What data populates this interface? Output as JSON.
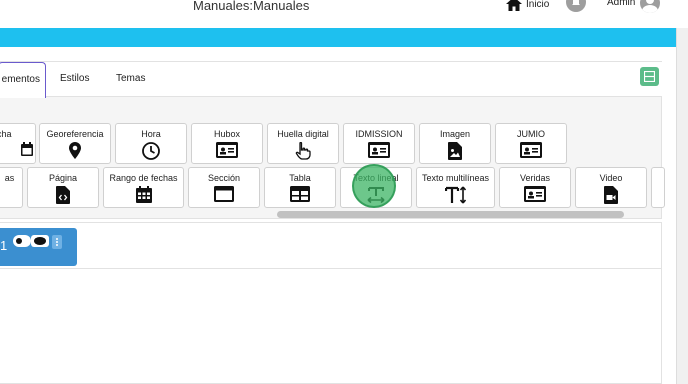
{
  "header": {
    "title": "Manuales:Manuales",
    "home_label": "Inicio",
    "user_label": "Admin"
  },
  "tabs": [
    {
      "label": "ementos"
    },
    {
      "label": "Estilos"
    },
    {
      "label": "Temas"
    }
  ],
  "components_row1": [
    {
      "label": "cha",
      "icon": "calendar-icon"
    },
    {
      "label": "Georeferencia",
      "icon": "map-pin-icon"
    },
    {
      "label": "Hora",
      "icon": "clock-icon"
    },
    {
      "label": "Hubox",
      "icon": "id-card-icon"
    },
    {
      "label": "Huella digital",
      "icon": "pointer-hand-icon"
    },
    {
      "label": "IDMISSION",
      "icon": "id-card-icon"
    },
    {
      "label": "Imagen",
      "icon": "image-file-icon"
    },
    {
      "label": "JUMIO",
      "icon": "id-card-icon"
    }
  ],
  "components_row2": [
    {
      "label": "as",
      "icon": "list-icon"
    },
    {
      "label": "Página",
      "icon": "code-file-icon"
    },
    {
      "label": "Rango de fechas",
      "icon": "calendar-grid-icon"
    },
    {
      "label": "Sección",
      "icon": "window-icon"
    },
    {
      "label": "Tabla",
      "icon": "table-icon"
    },
    {
      "label": "Texto lineal",
      "icon": "text-line-icon"
    },
    {
      "label": "Texto multilíneas",
      "icon": "text-height-icon"
    },
    {
      "label": "Veridas",
      "icon": "id-card-icon"
    },
    {
      "label": "Video",
      "icon": "video-file-icon"
    }
  ],
  "block": {
    "number": "1"
  },
  "colors": {
    "accent_band": "#1ec0ef",
    "block_header": "#3b8fd0",
    "layout_button": "#5cbc8a",
    "click_marker": "#3cb464"
  }
}
